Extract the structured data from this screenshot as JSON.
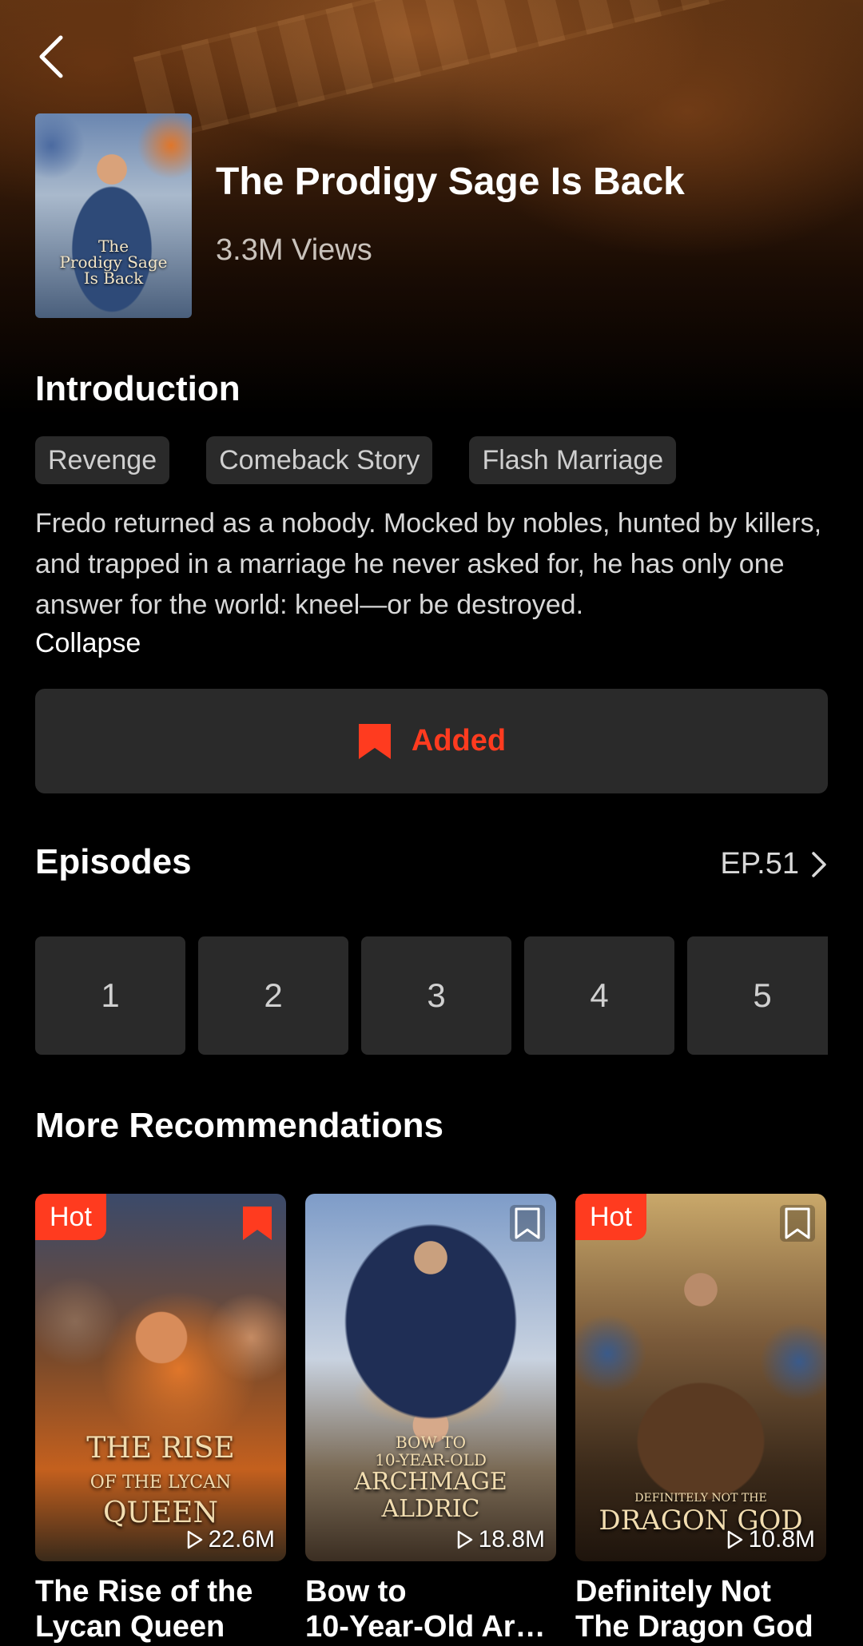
{
  "header": {
    "title": "The Prodigy Sage Is Back",
    "views": "3.3M Views",
    "cover_lettering": "The Prodigy Sage Is Back"
  },
  "introduction": {
    "heading": "Introduction",
    "tags": [
      "Revenge",
      "Comeback Story",
      "Flash Marriage"
    ],
    "description": "Fredo returned as a nobody. Mocked by nobles, hunted by killers, and trapped in a marriage he never asked for, he has only one answer for the world: kneel—or be destroyed.",
    "collapse_label": "Collapse"
  },
  "library_button": {
    "label": "Added",
    "accent_color": "#ff3b1f"
  },
  "episodes": {
    "heading": "Episodes",
    "total_label": "EP.51",
    "items": [
      "1",
      "2",
      "3",
      "4",
      "5"
    ]
  },
  "recommendations": {
    "heading": "More Recommendations",
    "items": [
      {
        "badge": "Hot",
        "bookmarked": true,
        "views": "22.6M",
        "title_line1": "The Rise of the",
        "title_line2": "Lycan Queen",
        "cover_lettering": "THE RISE OF THE LYCAN QUEEN"
      },
      {
        "badge": "",
        "bookmarked": false,
        "views": "18.8M",
        "title_line1": "Bow to",
        "title_line2": "10-Year-Old Arc...",
        "cover_lettering": "BOW TO 10-YEAR-OLD ARCHMAGE ALDRIC"
      },
      {
        "badge": "Hot",
        "bookmarked": false,
        "views": "10.8M",
        "title_line1": "Definitely Not",
        "title_line2": "The Dragon God",
        "cover_lettering": "DEFINITELY NOT THE DRAGON GOD"
      }
    ]
  }
}
